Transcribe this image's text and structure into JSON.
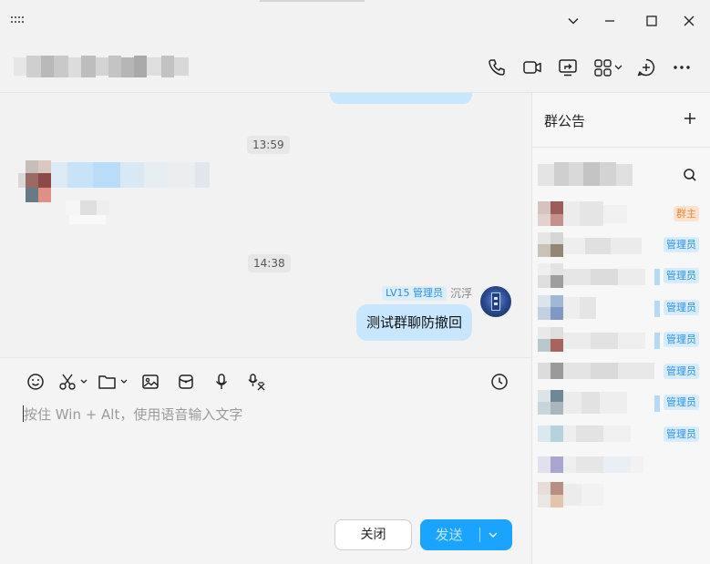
{
  "window": {
    "controls": [
      "chevron-down",
      "minimize",
      "maximize",
      "close"
    ]
  },
  "header": {
    "actions": [
      "phone-icon",
      "video-icon",
      "screen-share-icon",
      "apps-icon",
      "add-circle-icon",
      "more-icon"
    ]
  },
  "chat": {
    "timestamps": [
      "13:59",
      "14:38"
    ],
    "my_message": {
      "level_badge": "LV15 管理员",
      "sender": "沉浮",
      "text": "测试群聊防撤回"
    }
  },
  "toolbar": {
    "tools": [
      "emoji-icon",
      "screenshot-icon",
      "folder-icon",
      "image-icon",
      "red-packet-icon",
      "mic-icon",
      "voice-to-text-icon",
      "history-icon"
    ]
  },
  "composer": {
    "placeholder": "按住 Win + Alt，使用语音输入文字",
    "close_label": "关闭",
    "send_label": "发送"
  },
  "panel": {
    "title": "群公告",
    "members": [
      {
        "role": "群主",
        "type": "owner"
      },
      {
        "role": "管理员",
        "type": "admin"
      },
      {
        "role": "管理员",
        "type": "admin"
      },
      {
        "role": "管理员",
        "type": "admin"
      },
      {
        "role": "管理员",
        "type": "admin"
      },
      {
        "role": "管理员",
        "type": "admin"
      },
      {
        "role": "管理员",
        "type": "admin"
      },
      {
        "role": "管理员",
        "type": "admin"
      }
    ]
  },
  "colors": {
    "accent": "#1aa3ff",
    "bubble": "#c8e6fd",
    "owner_badge": "#f08a3a",
    "admin_badge": "#2b93e6"
  }
}
